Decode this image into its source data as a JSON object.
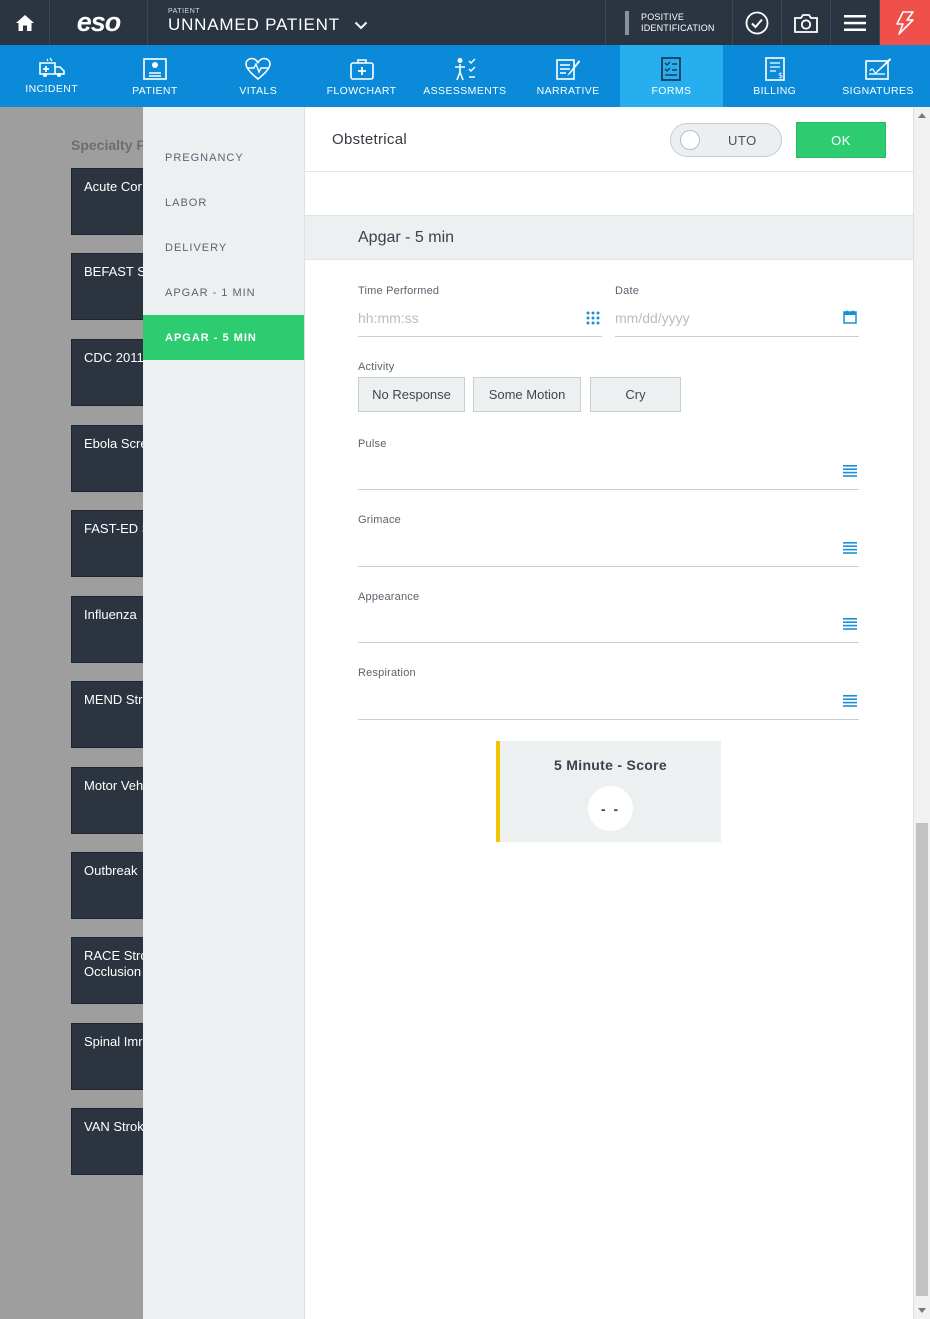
{
  "topbar": {
    "logo": "eso",
    "patient_label": "PATIENT",
    "patient_name": "UNNAMED PATIENT",
    "posid_line1": "POSITIVE",
    "posid_line2": "IDENTIFICATION",
    "icons": [
      "home-icon",
      "chevron-down-icon",
      "checkmark-circle-icon",
      "camera-icon",
      "menu-icon",
      "lightning-icon"
    ],
    "colors": {
      "bar": "#2b3441",
      "alert": "#f0504a"
    }
  },
  "nav": {
    "items": [
      {
        "label": "INCIDENT",
        "icon": "ambulance-icon"
      },
      {
        "label": "PATIENT",
        "icon": "patient-card-icon"
      },
      {
        "label": "VITALS",
        "icon": "heart-pulse-icon"
      },
      {
        "label": "FLOWCHART",
        "icon": "medkit-icon"
      },
      {
        "label": "ASSESSMENTS",
        "icon": "body-checklist-icon"
      },
      {
        "label": "NARRATIVE",
        "icon": "notepad-pen-icon"
      },
      {
        "label": "FORMS",
        "icon": "forms-checklist-icon"
      },
      {
        "label": "BILLING",
        "icon": "billing-doc-icon"
      },
      {
        "label": "SIGNATURES",
        "icon": "signature-icon"
      }
    ],
    "active": "FORMS",
    "colors": {
      "bg": "#0a8ad8",
      "active": "#27aeee"
    }
  },
  "background": {
    "section_title": "Specialty F",
    "tiles": [
      {
        "line1": "Acute Cor",
        "line2": ""
      },
      {
        "line1": "BEFAST St",
        "line2": ""
      },
      {
        "line1": "CDC 2011",
        "line2": ""
      },
      {
        "line1": "Ebola Scre",
        "line2": ""
      },
      {
        "line1": "FAST-ED S",
        "line2": ""
      },
      {
        "line1": "Influenza",
        "line2": ""
      },
      {
        "line1": "MEND Str",
        "line2": ""
      },
      {
        "line1": "Motor Veh",
        "line2": ""
      },
      {
        "line1": "Outbreak",
        "line2": ""
      },
      {
        "line1": "RACE Stro",
        "line2": "Occlusion"
      },
      {
        "line1": "Spinal Imr",
        "line2": ""
      },
      {
        "line1": "VAN Strok",
        "line2": ""
      }
    ]
  },
  "side": {
    "items": [
      "PREGNANCY",
      "LABOR",
      "DELIVERY",
      "APGAR - 1 MIN",
      "APGAR - 5 MIN"
    ],
    "active": "APGAR - 5 MIN"
  },
  "main": {
    "title": "Obstetrical",
    "uto_label": "UTO",
    "ok_label": "OK",
    "section_title": "Apgar - 5 min",
    "time_label": "Time Performed",
    "time_placeholder": "hh:mm:ss",
    "date_label": "Date",
    "date_placeholder": "mm/dd/yyyy",
    "activity_label": "Activity",
    "activity_options": [
      "No Response",
      "Some Motion",
      "Cry"
    ],
    "pulse_label": "Pulse",
    "grimace_label": "Grimace",
    "appearance_label": "Appearance",
    "respiration_label": "Respiration",
    "score_title": "5 Minute - Score",
    "score_value": "- -",
    "colors": {
      "ok": "#2ecc71",
      "score_accent": "#f2c400",
      "icon_blue": "#1a8fd8"
    }
  }
}
